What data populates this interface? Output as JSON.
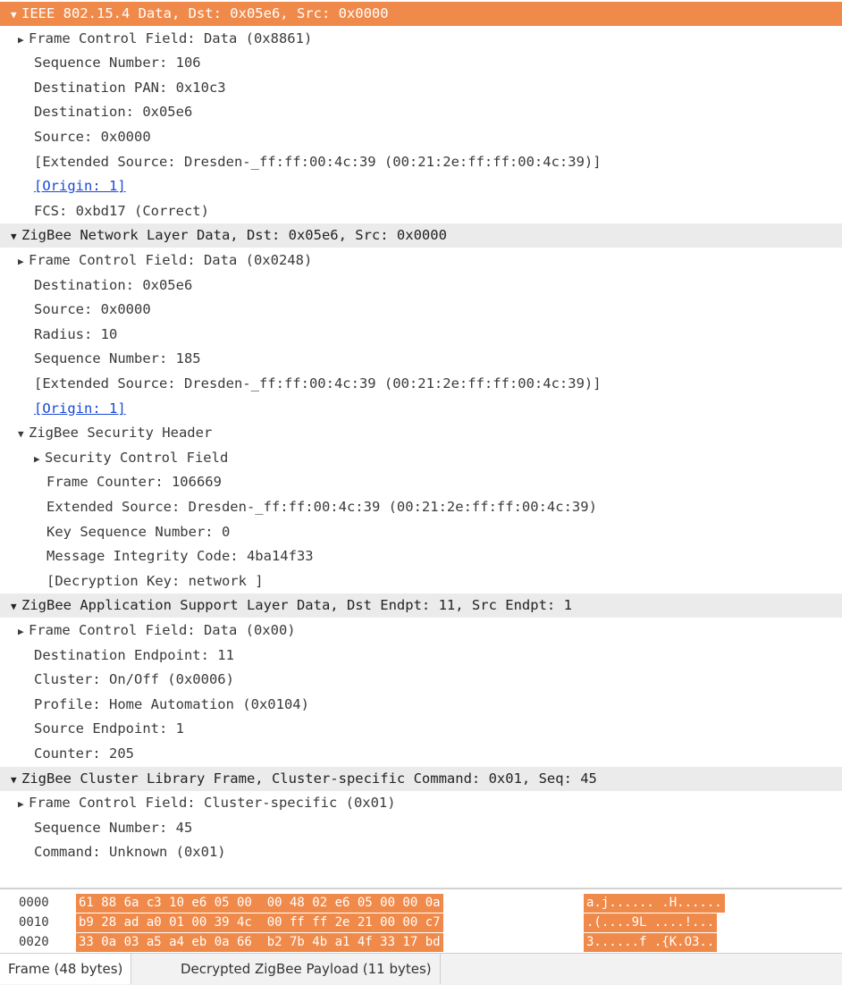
{
  "tree": [
    {
      "text": "IEEE 802.15.4 Data, Dst: 0x05e6, Src: 0x0000",
      "indent": 0,
      "expander": "down",
      "style": "selected",
      "name": "ieee-802154-node"
    },
    {
      "text": "Frame Control Field: Data (0x8861)",
      "indent": 1,
      "expander": "right",
      "style": "",
      "name": "ieee-frame-control-field"
    },
    {
      "text": "Sequence Number: 106",
      "indent": 2,
      "expander": "",
      "style": "",
      "name": "ieee-sequence-number"
    },
    {
      "text": "Destination PAN: 0x10c3",
      "indent": 2,
      "expander": "",
      "style": "",
      "name": "ieee-destination-pan"
    },
    {
      "text": "Destination: 0x05e6",
      "indent": 2,
      "expander": "",
      "style": "",
      "name": "ieee-destination"
    },
    {
      "text": "Source: 0x0000",
      "indent": 2,
      "expander": "",
      "style": "",
      "name": "ieee-source"
    },
    {
      "text": "[Extended Source: Dresden-_ff:ff:00:4c:39 (00:21:2e:ff:ff:00:4c:39)]",
      "indent": 2,
      "expander": "",
      "style": "",
      "name": "ieee-extended-source"
    },
    {
      "text": "[Origin: 1]",
      "indent": 2,
      "expander": "",
      "style": "link",
      "name": "ieee-origin-link"
    },
    {
      "text": "FCS: 0xbd17 (Correct)",
      "indent": 2,
      "expander": "",
      "style": "",
      "name": "ieee-fcs"
    },
    {
      "text": "ZigBee Network Layer Data, Dst: 0x05e6, Src: 0x0000",
      "indent": 0,
      "expander": "down",
      "style": "header",
      "name": "zigbee-nwk-node"
    },
    {
      "text": "Frame Control Field: Data (0x0248)",
      "indent": 1,
      "expander": "right",
      "style": "",
      "name": "nwk-frame-control-field"
    },
    {
      "text": "Destination: 0x05e6",
      "indent": 2,
      "expander": "",
      "style": "",
      "name": "nwk-destination"
    },
    {
      "text": "Source: 0x0000",
      "indent": 2,
      "expander": "",
      "style": "",
      "name": "nwk-source"
    },
    {
      "text": "Radius: 10",
      "indent": 2,
      "expander": "",
      "style": "",
      "name": "nwk-radius"
    },
    {
      "text": "Sequence Number: 185",
      "indent": 2,
      "expander": "",
      "style": "",
      "name": "nwk-sequence-number"
    },
    {
      "text": "[Extended Source: Dresden-_ff:ff:00:4c:39 (00:21:2e:ff:ff:00:4c:39)]",
      "indent": 2,
      "expander": "",
      "style": "",
      "name": "nwk-extended-source"
    },
    {
      "text": "[Origin: 1]",
      "indent": 2,
      "expander": "",
      "style": "link",
      "name": "nwk-origin-link"
    },
    {
      "text": "ZigBee Security Header",
      "indent": 1,
      "expander": "down",
      "style": "",
      "name": "zigbee-security-header-node"
    },
    {
      "text": "Security Control Field",
      "indent": 2,
      "expander": "right",
      "style": "",
      "name": "security-control-field"
    },
    {
      "text": "Frame Counter: 106669",
      "indent": 3,
      "expander": "",
      "style": "",
      "name": "security-frame-counter"
    },
    {
      "text": "Extended Source: Dresden-_ff:ff:00:4c:39 (00:21:2e:ff:ff:00:4c:39)",
      "indent": 3,
      "expander": "",
      "style": "",
      "name": "security-extended-source"
    },
    {
      "text": "Key Sequence Number: 0",
      "indent": 3,
      "expander": "",
      "style": "",
      "name": "security-key-sequence-number"
    },
    {
      "text": "Message Integrity Code: 4ba14f33",
      "indent": 3,
      "expander": "",
      "style": "",
      "name": "security-mic"
    },
    {
      "text": "[Decryption Key: network ]",
      "indent": 3,
      "expander": "",
      "style": "",
      "name": "security-decryption-key"
    },
    {
      "text": "ZigBee Application Support Layer Data, Dst Endpt: 11, Src Endpt: 1",
      "indent": 0,
      "expander": "down",
      "style": "header",
      "name": "zigbee-aps-node"
    },
    {
      "text": "Frame Control Field: Data (0x00)",
      "indent": 1,
      "expander": "right",
      "style": "",
      "name": "aps-frame-control-field"
    },
    {
      "text": "Destination Endpoint: 11",
      "indent": 2,
      "expander": "",
      "style": "",
      "name": "aps-destination-endpoint"
    },
    {
      "text": "Cluster: On/Off (0x0006)",
      "indent": 2,
      "expander": "",
      "style": "",
      "name": "aps-cluster"
    },
    {
      "text": "Profile: Home Automation (0x0104)",
      "indent": 2,
      "expander": "",
      "style": "",
      "name": "aps-profile"
    },
    {
      "text": "Source Endpoint: 1",
      "indent": 2,
      "expander": "",
      "style": "",
      "name": "aps-source-endpoint"
    },
    {
      "text": "Counter: 205",
      "indent": 2,
      "expander": "",
      "style": "",
      "name": "aps-counter"
    },
    {
      "text": "ZigBee Cluster Library Frame, Cluster-specific Command: 0x01, Seq: 45",
      "indent": 0,
      "expander": "down",
      "style": "header",
      "name": "zigbee-zcl-node"
    },
    {
      "text": "Frame Control Field: Cluster-specific (0x01)",
      "indent": 1,
      "expander": "right",
      "style": "",
      "name": "zcl-frame-control-field"
    },
    {
      "text": "Sequence Number: 45",
      "indent": 2,
      "expander": "",
      "style": "",
      "name": "zcl-sequence-number"
    },
    {
      "text": "Command: Unknown (0x01)",
      "indent": 2,
      "expander": "",
      "style": "",
      "name": "zcl-command"
    }
  ],
  "hex": [
    {
      "offset": "0000",
      "bytes": "61 88 6a c3 10 e6 05 00  00 48 02 e6 05 00 00 0a",
      "ascii": "a.j...... .H......"
    },
    {
      "offset": "0010",
      "bytes": "b9 28 ad a0 01 00 39 4c  00 ff ff 2e 21 00 00 c7",
      "ascii": ".(....9L ....!..."
    },
    {
      "offset": "0020",
      "bytes": "33 0a 03 a5 a4 eb 0a 66  b2 7b 4b a1 4f 33 17 bd",
      "ascii": "3......f .{K.O3.."
    }
  ],
  "tabs": [
    {
      "label": "Frame (48 bytes)",
      "active": true
    },
    {
      "label": "Decrypted ZigBee Payload (11 bytes)",
      "active": false
    }
  ]
}
